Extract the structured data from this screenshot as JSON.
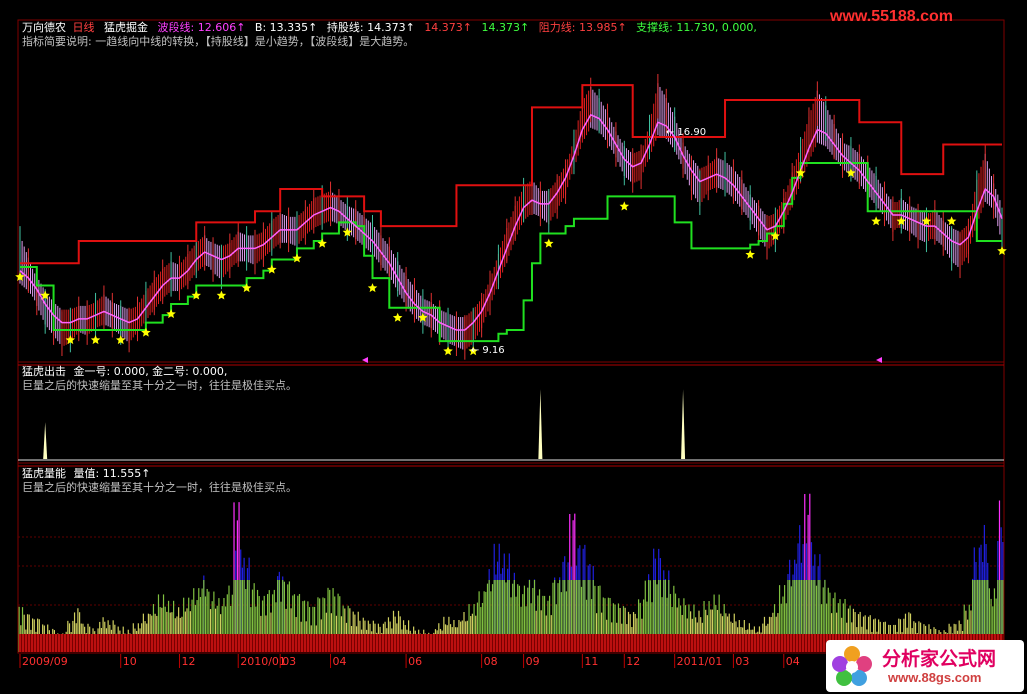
{
  "header": {
    "items": [
      {
        "text": "万向德农",
        "color": "#ffffff"
      },
      {
        "text": "日线",
        "color": "#ff4040"
      },
      {
        "text": "猛虎掘金",
        "color": "#ffffff"
      },
      {
        "text": "波段线: 12.606↑",
        "color": "#ff40ff"
      },
      {
        "text": "B: 13.335↑",
        "color": "#ffffff"
      },
      {
        "text": "持股线: 14.373↑",
        "color": "#ffffff"
      },
      {
        "text": "14.373↑",
        "color": "#ff4040"
      },
      {
        "text": "14.373↑",
        "color": "#40ff40"
      },
      {
        "text": "阻力线: 13.985↑",
        "color": "#ff4040"
      },
      {
        "text": "支撑线: 11.730, 0.000,",
        "color": "#40ff40"
      }
    ],
    "note": "指标简要说明: 一趋线向中线的转换，【持股线】是小趋势，【波段线】是大趋势。"
  },
  "watermark_top": "www.55188.com",
  "panel2": {
    "title": "猛虎出击",
    "values": "金一号: 0.000, 金二号: 0.000,",
    "note": "巨量之后的快速缩量至其十分之一时，往往是极佳买点。"
  },
  "panel3": {
    "title": "猛虎量能",
    "values": "量值: 11.555↑",
    "note": "巨量之后的快速缩量至其十分之一时，往往是极佳买点。"
  },
  "date_axis": [
    "2009/09",
    "10",
    "12",
    "2010/01",
    "03",
    "04",
    "06",
    "08",
    "09",
    "11",
    "12",
    "2011/01",
    "03",
    "04"
  ],
  "logo": {
    "name": "分析家公式网",
    "url": "www.88gs.com"
  },
  "colors": {
    "resistance": "#e01010",
    "support": "#20e020",
    "band_up": "#e02020",
    "band_down": "#e0a0f0",
    "star": "#ffff00",
    "volume_yellow": "#d0d060",
    "volume_green": "#80c040",
    "volume_blue": "#2020e0",
    "volume_magenta": "#ff30ff",
    "signal": "#ffffc0"
  },
  "chart_data": [
    {
      "type": "line",
      "title": "猛虎掘金",
      "x_start": "2009/09",
      "n": 118,
      "price": [
        11.8,
        11.2,
        10.6,
        10.1,
        9.8,
        9.5,
        9.6,
        9.9,
        9.8,
        10.0,
        10.2,
        10.0,
        9.8,
        9.6,
        9.9,
        10.3,
        10.6,
        10.9,
        11.1,
        11.0,
        11.3,
        11.6,
        11.8,
        11.5,
        11.3,
        11.6,
        11.9,
        11.8,
        11.7,
        11.9,
        12.2,
        12.4,
        12.3,
        12.2,
        12.5,
        12.8,
        12.9,
        13.0,
        12.8,
        12.6,
        12.5,
        12.3,
        12.1,
        11.8,
        11.5,
        11.1,
        10.7,
        10.4,
        10.1,
        10.0,
        9.8,
        9.6,
        9.5,
        9.4,
        9.6,
        10.0,
        10.6,
        11.3,
        12.0,
        12.6,
        13.1,
        13.3,
        13.0,
        12.8,
        13.2,
        13.6,
        14.4,
        15.4,
        15.8,
        15.5,
        15.1,
        14.6,
        14.1,
        13.9,
        14.0,
        14.8,
        15.9,
        15.5,
        15.0,
        14.3,
        13.7,
        13.3,
        13.7,
        13.9,
        13.8,
        13.6,
        13.3,
        12.9,
        12.5,
        12.1,
        12.3,
        12.8,
        13.5,
        14.2,
        15.0,
        15.7,
        15.3,
        14.8,
        14.3,
        14.2,
        14.0,
        13.7,
        13.4,
        13.0,
        12.6,
        12.8,
        12.6,
        12.4,
        12.3,
        12.5,
        12.2,
        11.8,
        11.6,
        12.0,
        13.3,
        14.0,
        13.2,
        12.3
      ],
      "band_line": [
        11.2,
        11.0,
        10.7,
        10.3,
        10.0,
        9.8,
        9.8,
        9.9,
        9.9,
        10.0,
        10.1,
        10.0,
        9.9,
        9.8,
        9.9,
        10.2,
        10.5,
        10.8,
        11.0,
        11.0,
        11.2,
        11.5,
        11.7,
        11.6,
        11.5,
        11.6,
        11.8,
        11.8,
        11.8,
        11.9,
        12.1,
        12.3,
        12.3,
        12.3,
        12.5,
        12.7,
        12.8,
        12.9,
        12.8,
        12.6,
        12.4,
        12.2,
        12.0,
        11.7,
        11.4,
        11.0,
        10.6,
        10.3,
        10.1,
        10.0,
        9.8,
        9.7,
        9.6,
        9.6,
        9.8,
        10.1,
        10.6,
        11.2,
        11.8,
        12.4,
        12.9,
        13.1,
        13.0,
        13.0,
        13.3,
        13.7,
        14.3,
        15.0,
        15.4,
        15.3,
        15.0,
        14.6,
        14.2,
        14.0,
        14.1,
        14.6,
        15.2,
        15.1,
        14.8,
        14.3,
        13.9,
        13.6,
        13.7,
        13.8,
        13.7,
        13.5,
        13.2,
        12.9,
        12.6,
        12.3,
        12.4,
        12.8,
        13.3,
        13.9,
        14.5,
        15.0,
        14.9,
        14.6,
        14.3,
        14.1,
        13.9,
        13.6,
        13.3,
        13.0,
        12.7,
        12.7,
        12.6,
        12.5,
        12.4,
        12.4,
        12.2,
        12.0,
        11.9,
        12.1,
        12.8,
        13.4,
        13.2,
        12.6
      ],
      "resistance": [
        11.4,
        11.4,
        11.4,
        11.4,
        11.4,
        11.4,
        11.4,
        12.0,
        12.0,
        12.0,
        12.0,
        12.0,
        12.0,
        12.0,
        12.0,
        12.0,
        12.0,
        12.0,
        12.0,
        12.0,
        12.0,
        12.5,
        12.5,
        12.5,
        12.5,
        12.5,
        12.5,
        12.5,
        12.8,
        12.8,
        12.8,
        13.4,
        13.4,
        13.4,
        13.4,
        13.4,
        13.2,
        13.2,
        13.2,
        13.2,
        13.2,
        12.8,
        12.8,
        12.4,
        12.4,
        12.4,
        12.4,
        12.4,
        12.4,
        12.4,
        12.4,
        12.4,
        13.5,
        13.5,
        13.5,
        13.5,
        13.5,
        13.5,
        13.5,
        13.5,
        13.5,
        15.6,
        15.6,
        15.6,
        15.6,
        15.6,
        15.6,
        16.2,
        16.2,
        16.2,
        16.2,
        16.2,
        16.2,
        14.8,
        14.8,
        14.8,
        14.8,
        14.8,
        14.8,
        14.8,
        14.8,
        14.8,
        14.8,
        14.8,
        15.8,
        15.8,
        15.8,
        15.8,
        15.8,
        15.8,
        15.8,
        15.8,
        15.8,
        15.8,
        15.8,
        15.8,
        15.8,
        15.8,
        15.8,
        15.8,
        15.2,
        15.2,
        15.2,
        15.2,
        15.2,
        13.8,
        13.8,
        13.8,
        13.8,
        13.8,
        14.6,
        14.6,
        14.6,
        14.6,
        14.6,
        14.6,
        14.6,
        14.6
      ],
      "support": [
        11.3,
        11.3,
        10.8,
        10.8,
        9.6,
        9.6,
        9.6,
        9.6,
        9.6,
        9.6,
        9.6,
        9.6,
        9.6,
        9.6,
        9.6,
        9.8,
        9.8,
        10.0,
        10.3,
        10.3,
        10.5,
        10.8,
        10.8,
        10.8,
        10.8,
        10.8,
        10.8,
        11.0,
        11.0,
        11.2,
        11.5,
        11.5,
        11.5,
        11.8,
        11.8,
        12.0,
        12.2,
        12.2,
        12.5,
        12.5,
        12.4,
        11.6,
        11.0,
        11.0,
        10.2,
        10.2,
        10.2,
        10.2,
        10.2,
        10.2,
        9.3,
        9.3,
        9.3,
        9.3,
        9.3,
        9.3,
        9.3,
        9.5,
        9.6,
        9.6,
        10.4,
        11.4,
        12.2,
        12.2,
        12.2,
        12.4,
        12.6,
        12.6,
        12.6,
        12.6,
        13.2,
        13.2,
        13.2,
        13.2,
        13.2,
        13.2,
        13.2,
        13.2,
        12.5,
        12.5,
        11.8,
        11.8,
        11.8,
        11.8,
        11.8,
        11.8,
        11.8,
        11.9,
        12.0,
        12.2,
        12.4,
        13.0,
        13.7,
        14.1,
        14.1,
        14.1,
        14.1,
        14.1,
        14.1,
        14.1,
        14.1,
        12.8,
        12.8,
        12.8,
        12.8,
        12.8,
        12.8,
        12.8,
        12.8,
        12.8,
        12.8,
        12.8,
        12.8,
        12.8,
        12.0,
        12.0,
        12.0,
        12.0
      ],
      "annotations": [
        {
          "text": "16.90"
        },
        {
          "text": "9.16"
        }
      ]
    },
    {
      "type": "bar",
      "title": "猛虎出击",
      "series": [
        {
          "name": "金一号",
          "spikes": [
            3,
            62,
            79
          ],
          "values": [
            0.45,
            0.85,
            0.85
          ]
        }
      ]
    },
    {
      "type": "bar",
      "title": "猛虎量能",
      "series": [
        {
          "name": "量值",
          "values": [
            0.3,
            0.25,
            0.22,
            0.18,
            0.15,
            0.12,
            0.2,
            0.28,
            0.18,
            0.15,
            0.22,
            0.2,
            0.16,
            0.14,
            0.18,
            0.24,
            0.3,
            0.36,
            0.32,
            0.28,
            0.34,
            0.4,
            0.48,
            0.38,
            0.34,
            0.42,
            0.95,
            0.6,
            0.44,
            0.36,
            0.4,
            0.52,
            0.46,
            0.38,
            0.34,
            0.3,
            0.36,
            0.42,
            0.38,
            0.3,
            0.26,
            0.22,
            0.2,
            0.18,
            0.22,
            0.26,
            0.2,
            0.16,
            0.14,
            0.12,
            0.18,
            0.22,
            0.2,
            0.25,
            0.3,
            0.38,
            0.52,
            0.68,
            0.62,
            0.5,
            0.42,
            0.46,
            0.4,
            0.36,
            0.48,
            0.62,
            0.9,
            0.7,
            0.58,
            0.44,
            0.36,
            0.32,
            0.3,
            0.26,
            0.34,
            0.5,
            0.66,
            0.52,
            0.42,
            0.34,
            0.3,
            0.26,
            0.32,
            0.36,
            0.3,
            0.24,
            0.2,
            0.18,
            0.16,
            0.22,
            0.3,
            0.42,
            0.58,
            0.8,
            1.0,
            0.62,
            0.46,
            0.38,
            0.34,
            0.3,
            0.26,
            0.24,
            0.22,
            0.2,
            0.18,
            0.22,
            0.26,
            0.2,
            0.18,
            0.16,
            0.14,
            0.18,
            0.2,
            0.3,
            0.66,
            0.8,
            0.4,
            0.95
          ]
        }
      ]
    }
  ]
}
